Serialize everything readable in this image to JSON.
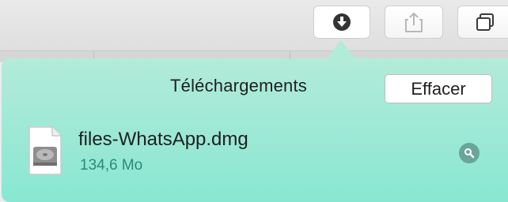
{
  "toolbar": {
    "buttons": [
      {
        "icon": "download-arrow-icon",
        "state": "active"
      },
      {
        "icon": "share-icon",
        "state": "disabled"
      },
      {
        "icon": "tabs-overview-icon",
        "state": "normal"
      }
    ]
  },
  "downloads": {
    "title": "Téléchargements",
    "clear_label": "Effacer",
    "items": [
      {
        "name": "files-WhatsApp.dmg",
        "size": "134,6 Mo",
        "icon": "disk-image-file-icon"
      }
    ]
  },
  "colors": {
    "popover_top": "#b3ebd9",
    "popover_bottom": "#88e7d2",
    "size_text": "#2b8a7a",
    "magnifier_circle": "#6aa59a"
  }
}
